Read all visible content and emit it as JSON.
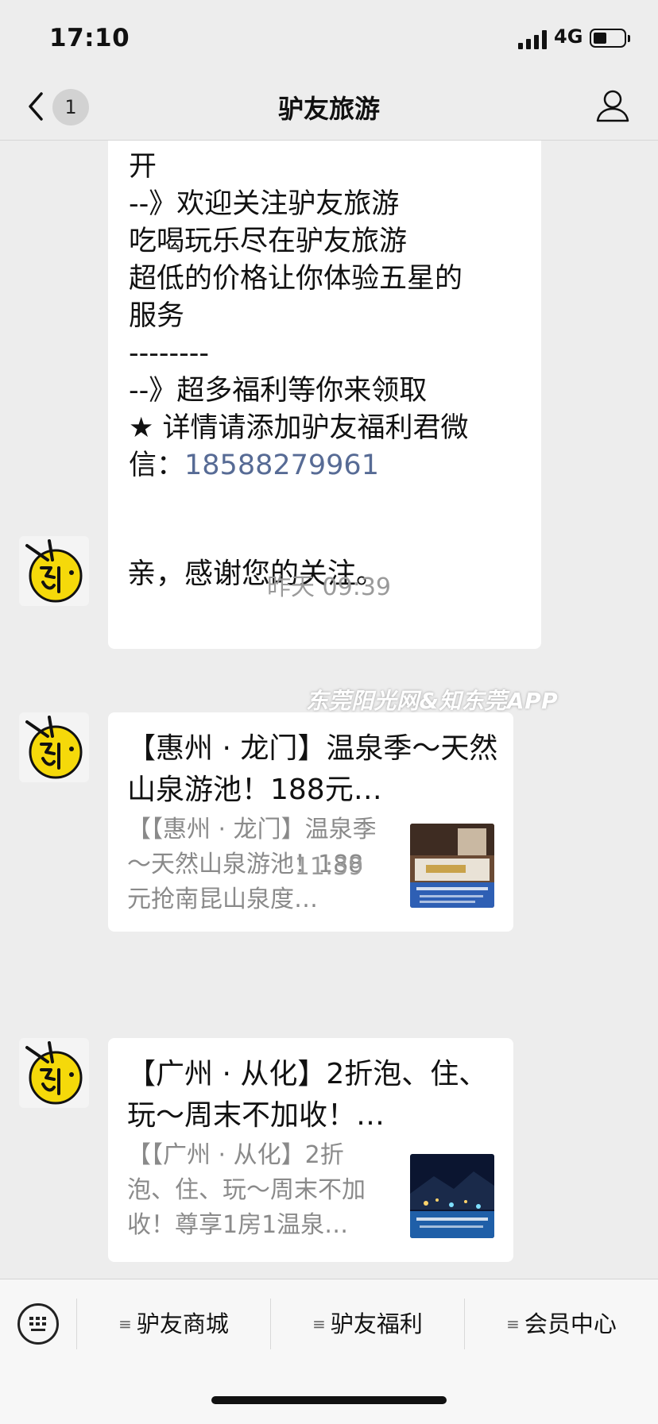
{
  "status": {
    "time": "17:10",
    "network": "4G"
  },
  "nav": {
    "unread_count": "1",
    "title": "驴友旅游"
  },
  "messages": {
    "long_text": {
      "lines": [
        "开",
        "",
        "--》欢迎关注驴友旅游",
        "吃喝玩乐尽在驴友旅游",
        "超低的价格让你体验五星的",
        "服务",
        "--------",
        "--》超多福利等你来领取",
        "★ 详情请添加驴友福利君微",
        "信："
      ],
      "phone": "18588279961"
    },
    "thanks": "亲，感谢您的关注。",
    "timestamp1": "昨天 09:39",
    "card1": {
      "title": "【惠州 · 龙门】温泉季～天然山泉游池！188元…",
      "desc": "【【惠州 · 龙门】温泉季～天然山泉游池！188元抢南昆山泉度…"
    },
    "timestamp2": "11:39",
    "card2": {
      "title": "【广州 · 从化】2折泡、住、玩～周末不加收！…",
      "desc": "【【广州 · 从化】2折泡、住、玩～周末不加收！尊享1房1温泉…"
    }
  },
  "watermark": "东莞阳光网&知东莞APP",
  "menu": {
    "items": [
      "驴友商城",
      "驴友福利",
      "会员中心"
    ]
  },
  "colors": {
    "background": "#ededed",
    "link": "#576b95",
    "bubble": "#ffffff"
  }
}
